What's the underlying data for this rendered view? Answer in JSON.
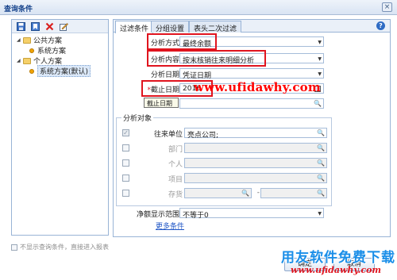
{
  "window": {
    "title": "查询条件",
    "close_label": "×"
  },
  "left": {
    "toolbar_icons": [
      "save-icon",
      "bookmark-icon",
      "delete-icon",
      "edit-icon"
    ],
    "tree": [
      {
        "label": "公共方案",
        "type": "folder",
        "level": 0
      },
      {
        "label": "系统方案",
        "type": "item",
        "level": 1
      },
      {
        "label": "个人方案",
        "type": "folder",
        "level": 0
      },
      {
        "label": "系统方案(默认)",
        "type": "item",
        "level": 1,
        "selected": true
      }
    ]
  },
  "tabs": [
    "过滤条件",
    "分组设置",
    "表头二次过滤"
  ],
  "help_label": "?",
  "form": {
    "analysis_method": {
      "label": "分析方式",
      "value": "最终余额"
    },
    "analysis_content": {
      "label": "分析内容",
      "value": "按末核销往来明细分析"
    },
    "analysis_date": {
      "label": "分析日期",
      "value": "凭证日期"
    },
    "cutoff_date": {
      "required_mark": "*",
      "label": "截止日期",
      "value": "2016"
    },
    "tooltip": "截止日期"
  },
  "group": {
    "title": "分析对象",
    "rows": [
      {
        "label": "往来单位",
        "value": "亮点公司;",
        "checked": true,
        "enabled": true
      },
      {
        "label": "部门",
        "value": "",
        "checked": false,
        "enabled": false
      },
      {
        "label": "个人",
        "value": "",
        "checked": false,
        "enabled": false
      },
      {
        "label": "项目",
        "value": "",
        "checked": false,
        "enabled": false
      },
      {
        "label": "存货",
        "value": "",
        "checked": false,
        "enabled": false,
        "range_sep": "-"
      }
    ]
  },
  "net_range": {
    "label": "净额显示范围",
    "value": "不等于0"
  },
  "more_link": "更多条件",
  "footer": {
    "no_show_label": "不显示查询条件，直接进入报表",
    "ok_label": "确定",
    "cancel_label": "取消"
  },
  "watermark": {
    "url": "www.ufidawhy.com",
    "brand": "用友软件免费下载",
    "url2": "www.ufidawhy.com"
  },
  "colors": {
    "highlight_red": "#e0141e",
    "link_blue": "#1f56c6",
    "brand_blue": "#1a8ee8"
  }
}
